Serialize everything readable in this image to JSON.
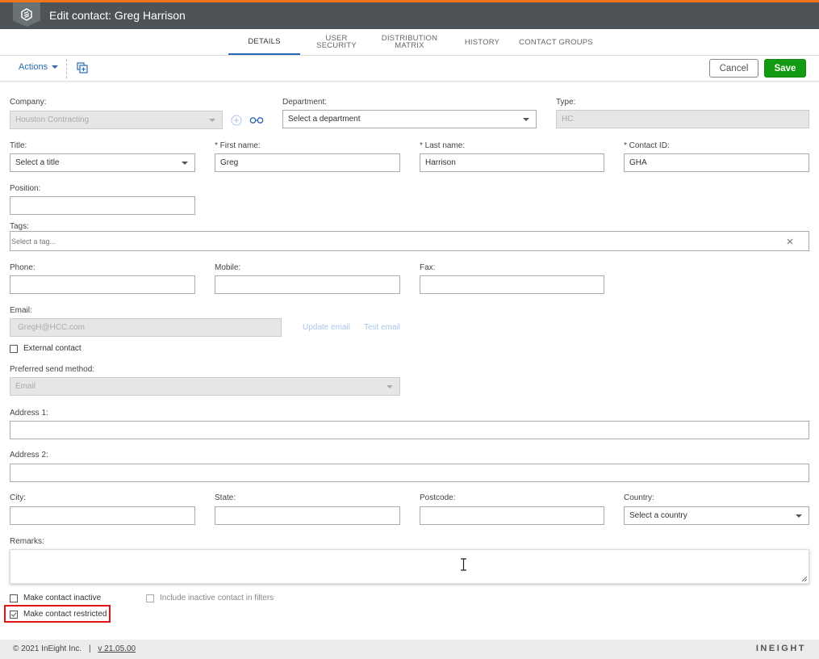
{
  "header": {
    "title": "Edit contact: Greg Harrison",
    "accent_color": "#f0761e",
    "bar_color": "#4d5356",
    "logo_icon": "ineight-logo-icon"
  },
  "tabs": [
    {
      "label": "DETAILS",
      "active": true
    },
    {
      "label": "USER SECURITY",
      "active": false
    },
    {
      "label": "DISTRIBUTION MATRIX",
      "active": false
    },
    {
      "label": "HISTORY",
      "active": false
    },
    {
      "label": "CONTACT GROUPS",
      "active": false
    }
  ],
  "toolbar": {
    "actions_label": "Actions",
    "cancel_label": "Cancel",
    "save_label": "Save",
    "save_color": "#139a13"
  },
  "form": {
    "company": {
      "label": "Company:",
      "value": "Houston Contracting"
    },
    "department": {
      "label": "Department:",
      "value": "Select a department"
    },
    "type": {
      "label": "Type:",
      "value": "HC"
    },
    "title": {
      "label": "Title:",
      "value": "Select a title"
    },
    "first_name": {
      "label": "* First name:",
      "value": "Greg"
    },
    "last_name": {
      "label": "* Last name:",
      "value": "Harrison"
    },
    "contact_id": {
      "label": "* Contact ID:",
      "value": "GHA"
    },
    "position": {
      "label": "Position:",
      "value": ""
    },
    "tags": {
      "label": "Tags:",
      "placeholder": "Select a tag..."
    },
    "phone": {
      "label": "Phone:",
      "value": ""
    },
    "mobile": {
      "label": "Mobile:",
      "value": ""
    },
    "fax": {
      "label": "Fax:",
      "value": ""
    },
    "email": {
      "label": "Email:",
      "value": "GregH@HCC.com",
      "update_link": "Update email",
      "test_link": "Test email"
    },
    "external_contact": {
      "label": "External contact",
      "checked": false
    },
    "send_method": {
      "label": "Preferred send method:",
      "value": "Email"
    },
    "address1": {
      "label": "Address 1:",
      "value": ""
    },
    "address2": {
      "label": "Address 2:",
      "value": ""
    },
    "city": {
      "label": "City:",
      "value": ""
    },
    "state": {
      "label": "State:",
      "value": ""
    },
    "postcode": {
      "label": "Postcode:",
      "value": ""
    },
    "country": {
      "label": "Country:",
      "value": "Select a country"
    },
    "remarks": {
      "label": "Remarks:",
      "value": ""
    },
    "make_inactive": {
      "label": "Make contact inactive",
      "checked": false
    },
    "include_inactive": {
      "label": "Include inactive contact in filters",
      "checked": false
    },
    "make_restricted": {
      "label": "Make contact restricted",
      "checked": true
    }
  },
  "footer": {
    "copyright": "© 2021 InEight Inc.",
    "separator": "|",
    "version": "v 21.05.00",
    "brand": "INEIGHT"
  }
}
